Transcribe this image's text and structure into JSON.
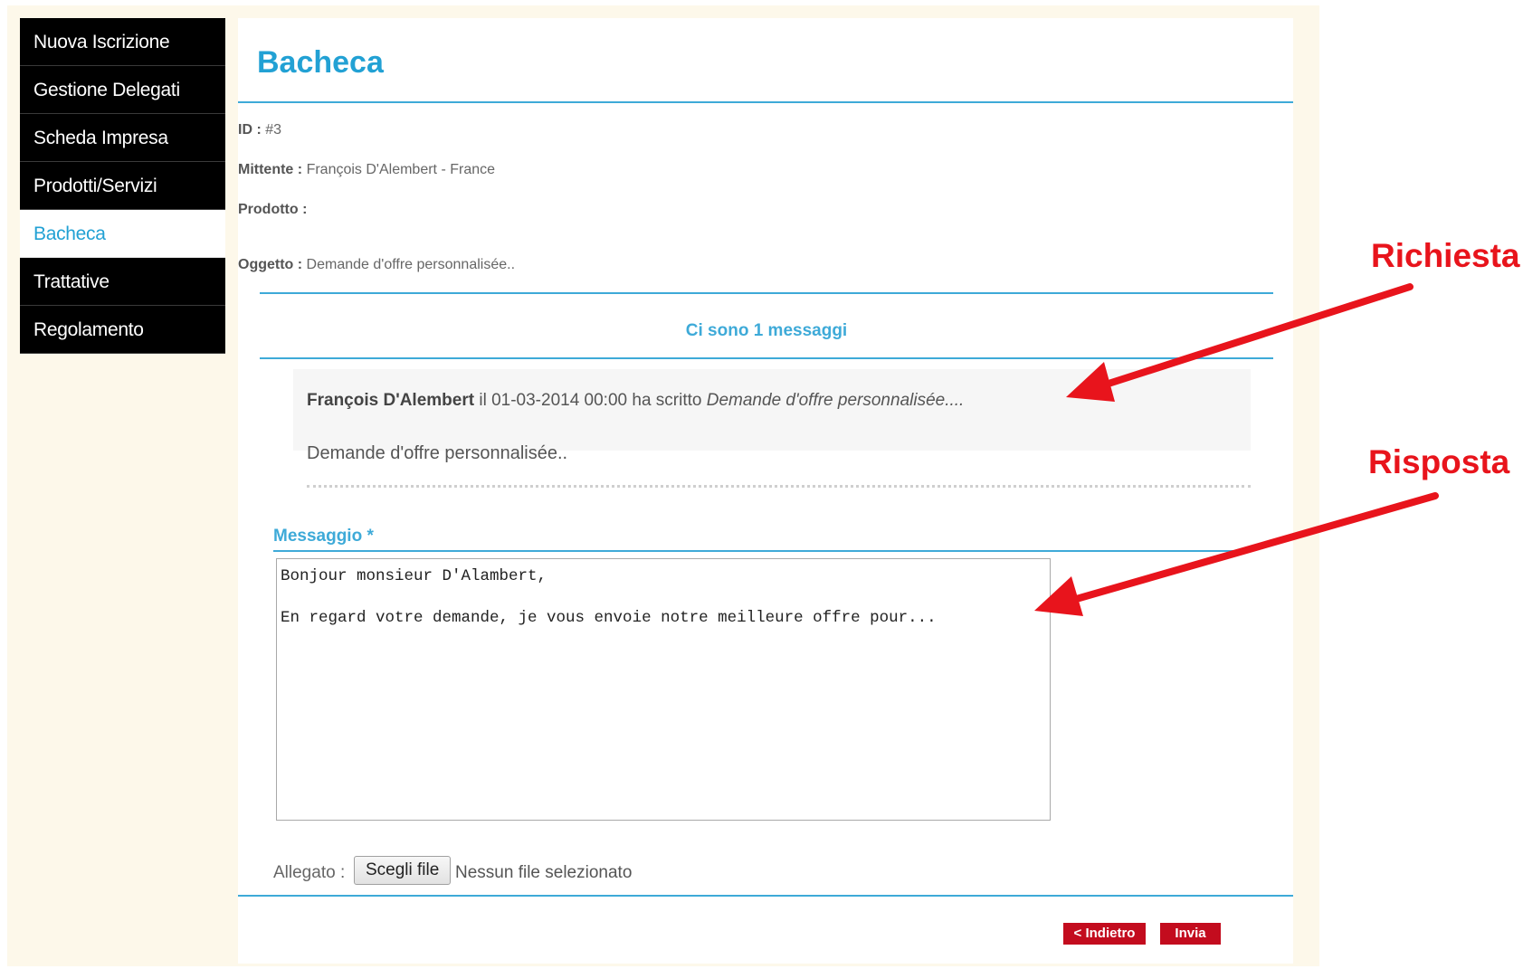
{
  "sidebar": {
    "items": [
      {
        "label": "Nuova Iscrizione"
      },
      {
        "label": "Gestione Delegati"
      },
      {
        "label": "Scheda Impresa"
      },
      {
        "label": "Prodotti/Servizi"
      },
      {
        "label": "Bacheca"
      },
      {
        "label": "Trattative"
      },
      {
        "label": "Regolamento"
      }
    ],
    "active": "Bacheca"
  },
  "page": {
    "title": "Bacheca"
  },
  "details": {
    "id_label": "ID :",
    "id_value": "#3",
    "mittente_label": "Mittente :",
    "mittente_value": "François D'Alembert - France",
    "prodotto_label": "Prodotto :",
    "prodotto_value": "",
    "oggetto_label": "Oggetto :",
    "oggetto_value": "Demande d'offre personnalisée.."
  },
  "messages": {
    "count_text": "Ci sono 1 messaggi",
    "items": [
      {
        "author": "François D'Alembert",
        "meta": " il 01-03-2014 00:00 ha scritto ",
        "subject": "Demande d'offre personnalisée....",
        "body": "Demande d'offre personnalisée.."
      }
    ]
  },
  "reply": {
    "label": "Messaggio *",
    "value": "Bonjour monsieur D'Alambert,\n\nEn regard votre demande, je vous envoie notre meilleure offre pour...",
    "attachment_label": "Allegato :",
    "choose_file_label": "Scegli file",
    "no_file_text": "Nessun file selezionato"
  },
  "buttons": {
    "back_label": "< Indietro",
    "send_label": "Invia"
  },
  "annotations": {
    "request_label": "Richiesta",
    "reply_label": "Risposta",
    "color": "#e8141c"
  },
  "colors": {
    "accent": "#22a1d4",
    "button_red": "#c30c1e",
    "sidebar_bg": "#000000",
    "frame_bg": "#fdf8ea"
  }
}
